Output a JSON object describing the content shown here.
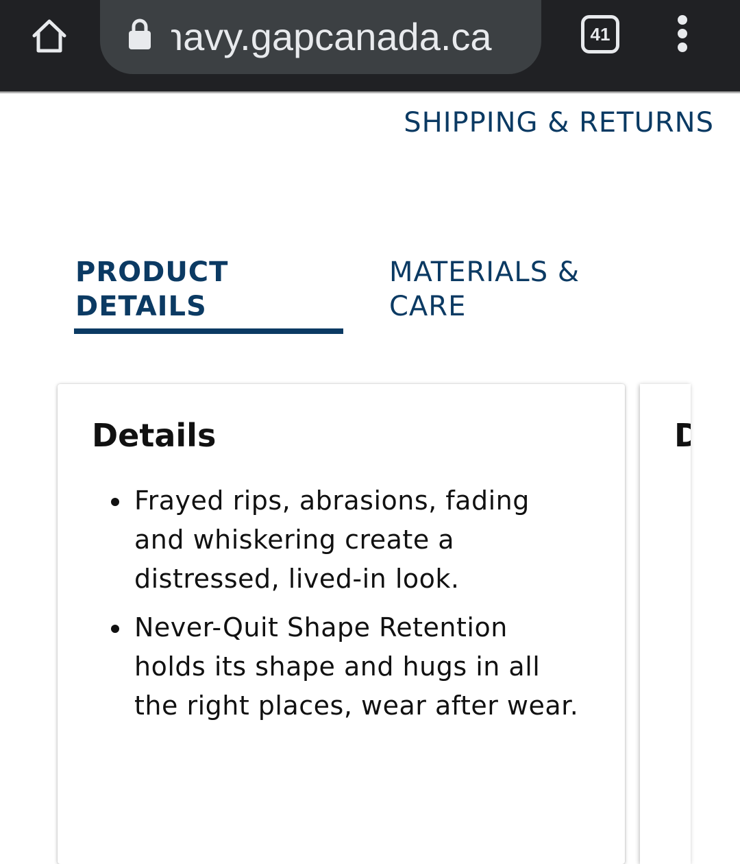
{
  "browser": {
    "url": "navy.gapcanada.ca",
    "tab_count": "41",
    "icons": {
      "home": "home-icon",
      "lock": "lock-icon",
      "menu": "more-vert-icon"
    },
    "colors": {
      "toolbar": "#202124",
      "url_pill": "#3c4043",
      "toolbar_text": "#e8eaed"
    }
  },
  "page": {
    "shipping_link": "SHIPPING & RETURNS",
    "tabs": [
      {
        "label_line1": "PRODUCT",
        "label_line2": "DETAILS",
        "selected": true
      },
      {
        "label_line1": "MATERIALS &",
        "label_line2": "CARE",
        "selected": false
      }
    ],
    "details_card": {
      "title": "Details",
      "items": [
        "Frayed rips, abrasions, fading and whiskering create a distressed, lived-in look.",
        "Never-Quit Shape Retention holds its shape and hugs in all the right places, wear after wear."
      ]
    },
    "next_card": {
      "title_partial": "D"
    },
    "colors": {
      "brand_navy": "#0b3a63",
      "text": "#111111"
    }
  }
}
